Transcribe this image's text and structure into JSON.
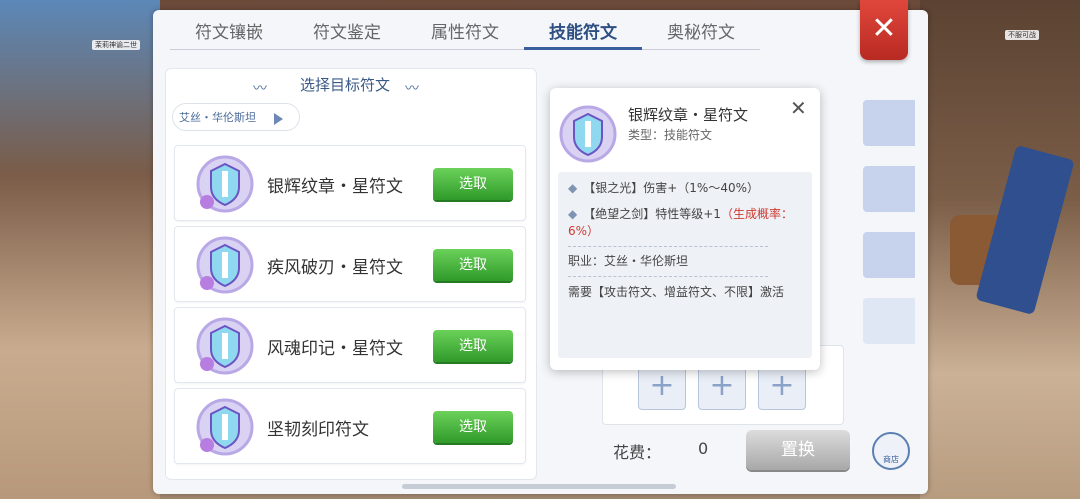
{
  "tabs": [
    "符文镶嵌",
    "符文鉴定",
    "属性符文",
    "技能符文",
    "奥秘符文"
  ],
  "active_tab": 3,
  "close_label": "✕",
  "select_target_title": "选择目标符文",
  "class_filter": "艾丝・华伦斯坦",
  "runes": [
    {
      "name": "银辉纹章・星符文",
      "button": "选取"
    },
    {
      "name": "疾风破刃・星符文",
      "button": "选取"
    },
    {
      "name": "风魂印记・星符文",
      "button": "选取"
    },
    {
      "name": "坚韧刻印符文",
      "button": "选取"
    }
  ],
  "tooltip": {
    "name": "银辉纹章・星符文",
    "type": "类型：技能符文",
    "effect1": "【银之光】伤害+（1%～40%）",
    "effect2_main": "【绝望之剑】特性等级+1",
    "effect2_note": "（生成概率：6%）",
    "job": "职业：艾丝・华伦斯坦",
    "require": "需要【攻击符文、增益符文、不限】激活",
    "close": "✕"
  },
  "slots": [
    "+",
    "+",
    "+"
  ],
  "cost_label": "花费：",
  "cost_value": "0",
  "swap_button": "置换",
  "shop_label": "商店",
  "bg_tags": [
    "茉莉神谕二世",
    "不服可战"
  ],
  "colors": {
    "accent": "#3a5f9f",
    "select_green": "#3aa832",
    "close_red": "#d23a2f"
  }
}
